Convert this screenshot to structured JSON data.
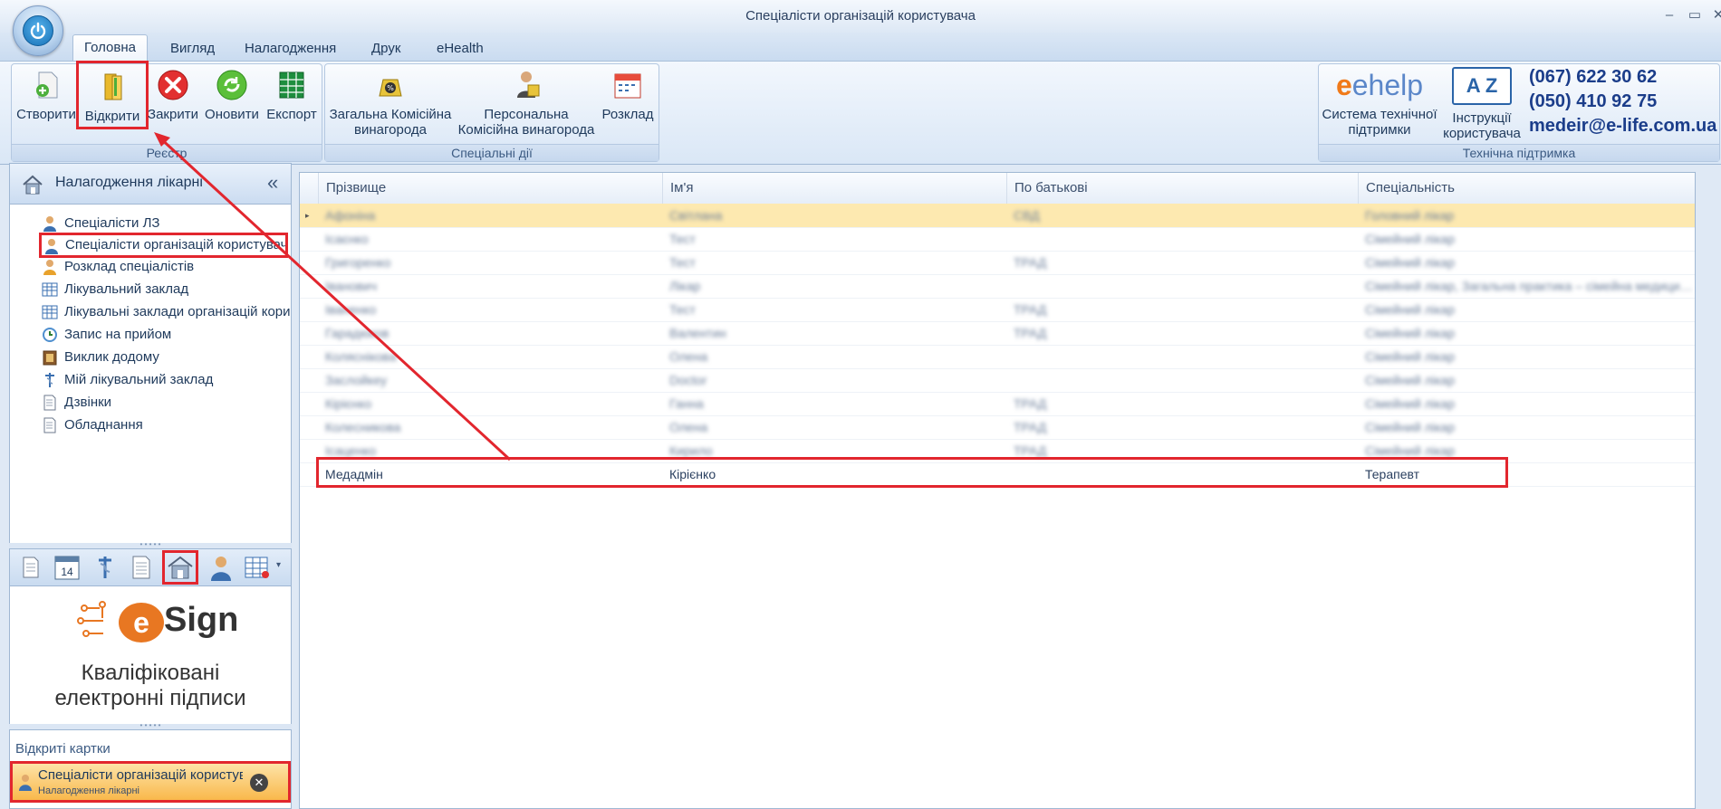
{
  "window": {
    "title": "Спеціалісти організацій користувача",
    "minimize": "–",
    "restore": "▭",
    "close": "✕"
  },
  "ribbon_tabs": [
    "Головна",
    "Вигляд",
    "Налагодження",
    "Друк",
    "eHealth"
  ],
  "groups": {
    "registry": {
      "label": "Реєстр",
      "buttons": [
        "Створити",
        "Відкрити",
        "Закрити",
        "Оновити",
        "Експорт"
      ]
    },
    "special": {
      "label": "Спеціальні дії",
      "buttons": [
        "Загальна Комісійна винагорода",
        "Персональна Комісійна винагорода",
        "Розклад"
      ]
    },
    "support": {
      "label": "Технічна підтримка",
      "buttons": [
        "Система технічної підтримки",
        "Інструкції користувача"
      ],
      "phone1": "(067) 622 30 62",
      "phone2": "(050) 410 92 75",
      "email": "medeir@e-life.com.ua",
      "ehelp_logo": "ehelp",
      "az_logo": "A Z"
    }
  },
  "nav": {
    "header": "Налагодження лікарні",
    "collapse": "«",
    "items": [
      {
        "label": "Спеціалісти ЛЗ",
        "icon": "user-icon"
      },
      {
        "label": "Спеціалісти організацій користувача",
        "icon": "user-icon"
      },
      {
        "label": "Розклад спеціалістів",
        "icon": "user-clock-icon"
      },
      {
        "label": "Лікувальний заклад",
        "icon": "building-grid-icon"
      },
      {
        "label": "Лікувальні заклади організацій користувача",
        "icon": "building-grid-icon"
      },
      {
        "label": "Запис на прийом",
        "icon": "appointment-icon"
      },
      {
        "label": "Виклик додому",
        "icon": "house-call-icon"
      },
      {
        "label": "Мій лікувальний заклад",
        "icon": "caduceus-icon"
      },
      {
        "label": "Дзвінки",
        "icon": "document-icon"
      },
      {
        "label": "Обладнання",
        "icon": "document-icon"
      }
    ]
  },
  "strip_calendar_day": "14",
  "esign": {
    "logo_text": "Sign",
    "logo_e": "e",
    "line1": "Кваліфіковані",
    "line2": "електронні підписи"
  },
  "open_cards": {
    "title": "Відкриті картки",
    "card_title": "Спеціалісти організацій користувача",
    "card_subtitle": "Налагодження лікарні"
  },
  "grid": {
    "columns": [
      "Прізвище",
      "Ім'я",
      "По батькові",
      "Спеціальність"
    ],
    "rows": [
      [
        "Афоніна",
        "Світлана",
        "СВД",
        "Головний лікар"
      ],
      [
        "Ісаєнко",
        "Тест",
        "",
        "Сімейний лікар"
      ],
      [
        "Григоренко",
        "Тест",
        "ТРАД",
        "Сімейний лікар"
      ],
      [
        "Іванович",
        "Лікар",
        "",
        "Сімейний лікар, Загальна практика – сімейна медицина"
      ],
      [
        "Іваненко",
        "Тест",
        "ТРАД",
        "Сімейний лікар"
      ],
      [
        "Гарадюков",
        "Валентин",
        "ТРАД",
        "Сімейний лікар"
      ],
      [
        "Коляснікова",
        "Олена",
        "",
        "Сімейний лікар"
      ],
      [
        "Заслойкеу",
        "Doctor",
        "",
        "Сімейний лікар"
      ],
      [
        "Кірієнко",
        "Ганна",
        "ТРАД",
        "Сімейний лікар"
      ],
      [
        "Колесникова",
        "Олена",
        "ТРАД",
        "Сімейний лікар"
      ],
      [
        "Ісаценко",
        "Кирило",
        "ТРАД",
        "Сімейний лікар"
      ],
      [
        "Медадмін",
        "Кірієнко",
        "",
        "Терапевт"
      ]
    ]
  },
  "colors": {
    "highlight": "#e2262e",
    "selected_row": "#fde9b0",
    "accent": "#1e395b"
  }
}
